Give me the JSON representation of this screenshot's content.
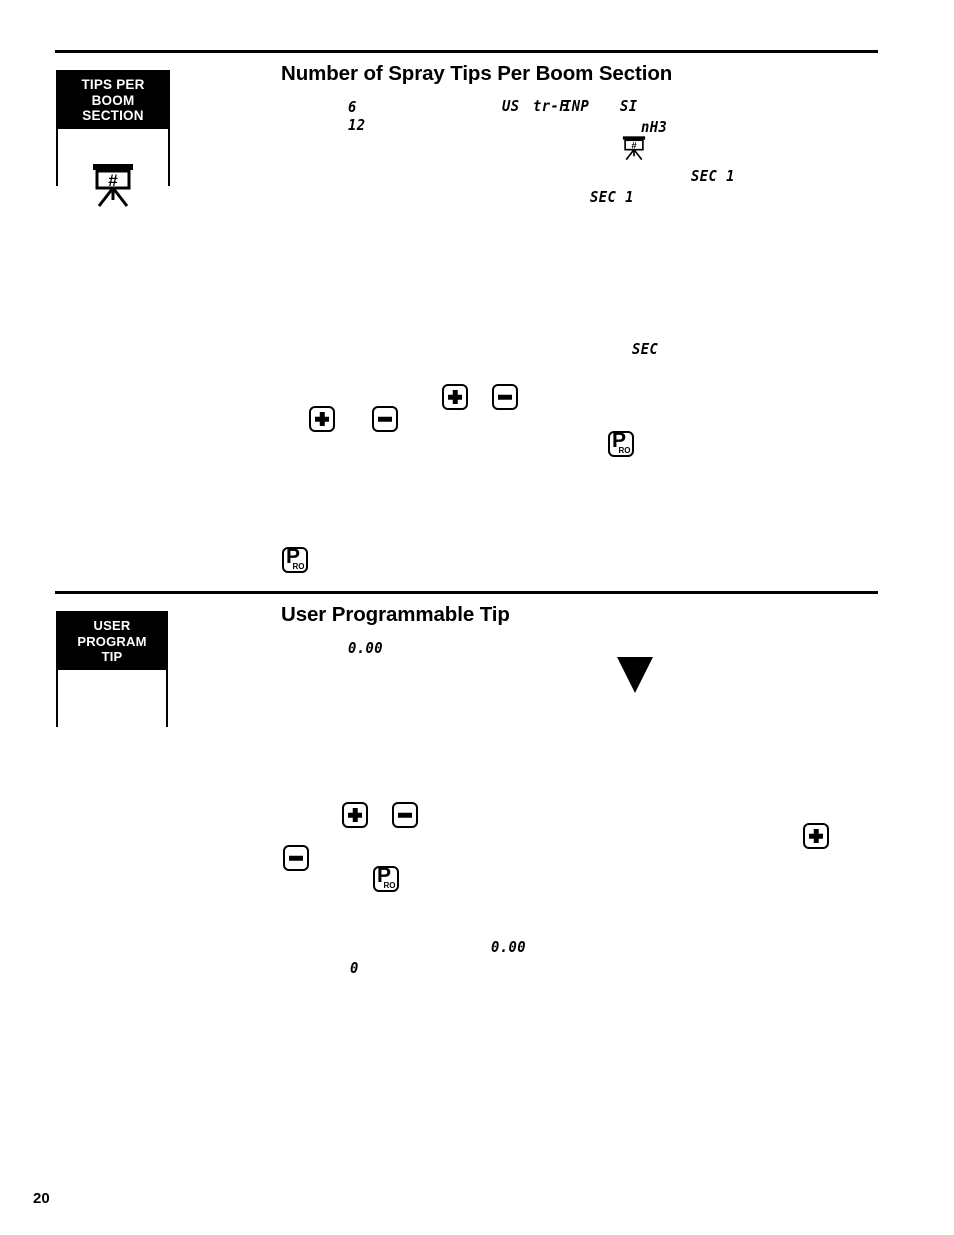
{
  "page": {
    "number": "20"
  },
  "sections": [
    {
      "id": "tips-per-boom-section",
      "heading": "Number of Spray Tips Per Boom Section",
      "key_box": {
        "header_lines": [
          "TIPS PER",
          "BOOM",
          "SECTION"
        ],
        "icon": "boom-hash-icon"
      },
      "readouts": [
        {
          "name": "tip-count-6",
          "text": "6"
        },
        {
          "name": "tip-count-12",
          "text": "12"
        },
        {
          "name": "unit-us",
          "text": "US"
        },
        {
          "name": "unit-tr-f",
          "text": "tr-F"
        },
        {
          "name": "unit-inp",
          "text": "INP"
        },
        {
          "name": "unit-si",
          "text": "SI"
        },
        {
          "name": "unit-nh3",
          "text": "nH3"
        },
        {
          "name": "section-sec-1-a",
          "text": "SEC 1"
        },
        {
          "name": "section-sec-1-b",
          "text": "SEC 1"
        },
        {
          "name": "section-sec",
          "text": "SEC"
        }
      ]
    },
    {
      "id": "user-programmable-tip",
      "heading": "User Programmable Tip",
      "key_box": {
        "header_lines": [
          "USER",
          "PROGRAM",
          "TIP"
        ],
        "icon": "blank-icon"
      },
      "readouts": [
        {
          "name": "tip-value-top",
          "text": "0.00"
        },
        {
          "name": "tip-value-bottom",
          "text": "0.00"
        },
        {
          "name": "tip-value-zero",
          "text": "0"
        }
      ]
    }
  ],
  "keys": {
    "plus_label": "+",
    "minus_label": "−",
    "pro_p": "P",
    "pro_ro": "RO"
  },
  "colors": {
    "ink": "#000000",
    "paper": "#ffffff"
  }
}
